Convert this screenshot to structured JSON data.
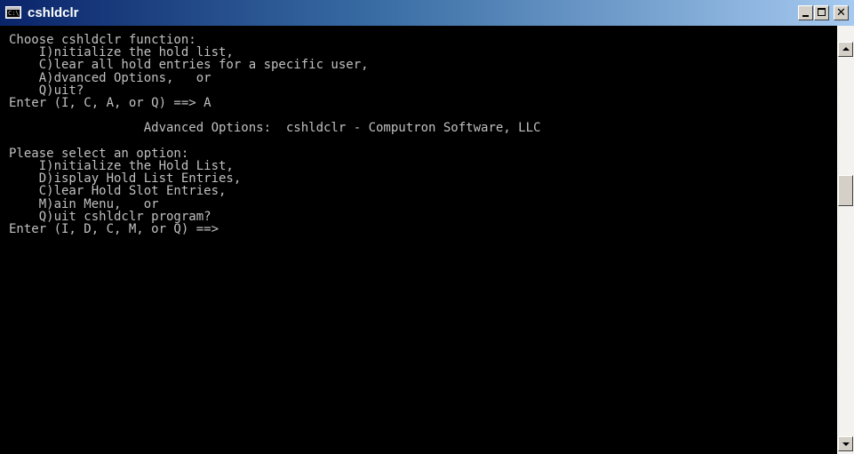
{
  "window": {
    "title": "cshldclr",
    "icon": "console-icon",
    "icon_text": "C:\\"
  },
  "controls": {
    "minimize_icon": "minimize-icon",
    "maximize_icon": "maximize-icon",
    "close_icon": "close-icon",
    "close_glyph": "✕"
  },
  "console": {
    "lines": [
      "Choose cshldclr function:",
      "    I)nitialize the hold list,",
      "    C)lear all hold entries for a specific user,",
      "    A)dvanced Options,   or",
      "    Q)uit?",
      "Enter (I, C, A, or Q) ==> A",
      "",
      "                  Advanced Options:  cshldclr - Computron Software, LLC",
      "",
      "Please select an option:",
      "    I)nitialize the Hold List,",
      "    D)isplay Hold List Entries,",
      "    C)lear Hold Slot Entries,",
      "    M)ain Menu,   or",
      "    Q)uit cshldclr program?",
      "Enter (I, D, C, M, or Q) ==>"
    ]
  },
  "colors": {
    "console_bg": "#000000",
    "console_fg": "#c0c0c0",
    "titlebar_start": "#0a246a",
    "titlebar_end": "#a6caf0"
  }
}
